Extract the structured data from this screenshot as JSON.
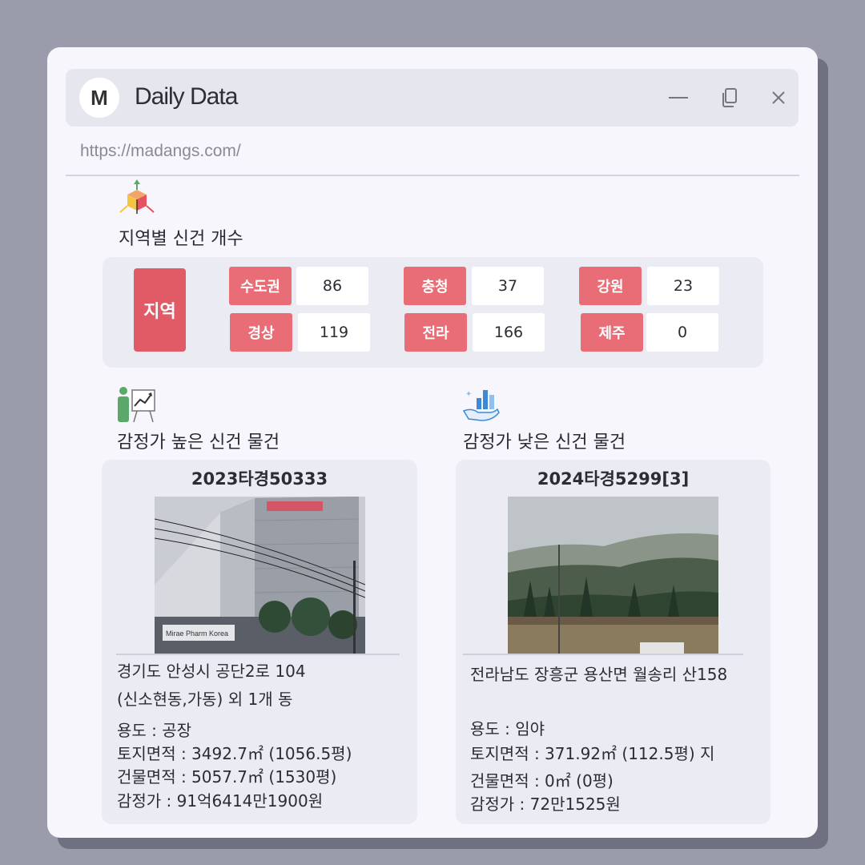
{
  "window": {
    "avatar_letter": "M",
    "title": "Daily Data",
    "url": "https://madangs.com/"
  },
  "icons": {
    "minimize": "minimize-icon",
    "copy": "copy-icon",
    "close": "close-icon"
  },
  "region_section": {
    "title": "지역별 신건 개수",
    "main_label": "지역",
    "items": [
      {
        "label": "수도권",
        "value": "86"
      },
      {
        "label": "충청",
        "value": "37"
      },
      {
        "label": "강원",
        "value": "23"
      },
      {
        "label": "경상",
        "value": "119"
      },
      {
        "label": "전라",
        "value": "166"
      },
      {
        "label": "제주",
        "value": "0"
      }
    ]
  },
  "high_section": {
    "title": "감정가 높은 신건 물건",
    "case_no": "2023타경50333",
    "address_line1": "경기도 안성시 공단2로 104",
    "address_line2": "(신소현동,가동) 외 1개 동",
    "usage": "용도 : 공장",
    "land_area": "토지면적 : 3492.7㎡ (1056.5평)",
    "building_area": "건물면적 : 5057.7㎡ (1530평)",
    "appraisal": "감정가 : 91억6414만1900원",
    "sign_text": "Mirae Pharm Korea"
  },
  "low_section": {
    "title": "감정가 낮은 신건 물건",
    "case_no": "2024타경5299[3]",
    "address_line1": "전라남도 장흥군 용산면 월송리 산158",
    "usage": "용도 : 임야",
    "land_area": "토지면적 : 371.92㎡ (112.5평) 지",
    "building_area": "건물면적 : 0㎡ (0평)",
    "appraisal": "감정가 : 72만1525원"
  },
  "colors": {
    "accent": "#e96d76",
    "accent_dark": "#e05b66",
    "panel": "#ebebf4",
    "background": "#9a9bab"
  }
}
